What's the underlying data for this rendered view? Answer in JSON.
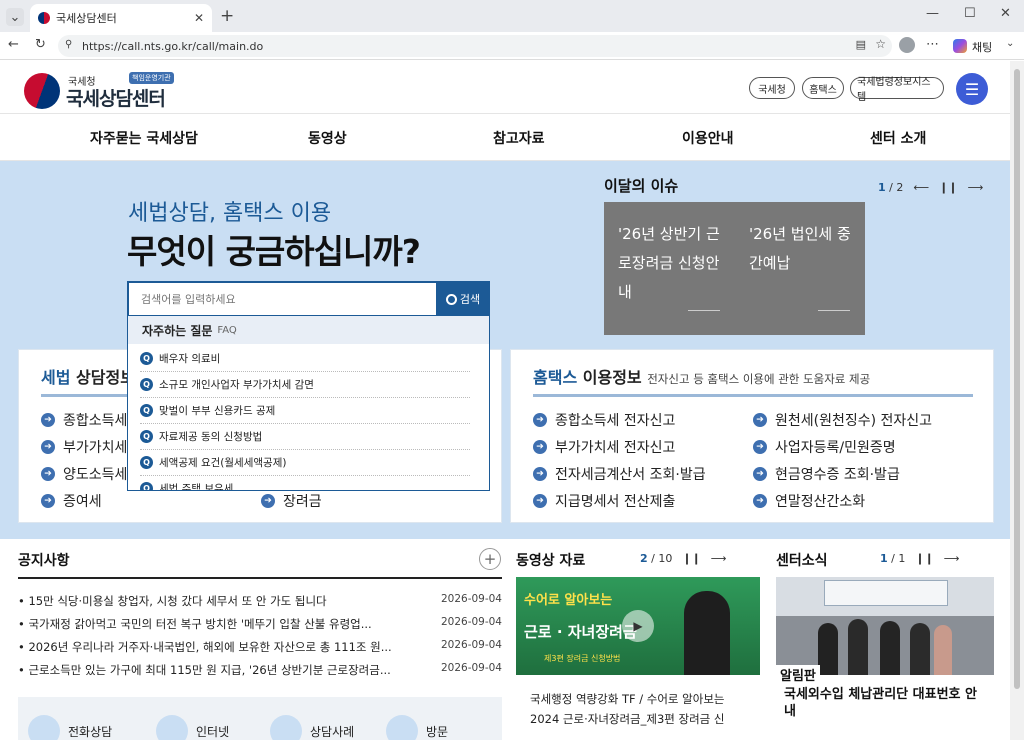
{
  "browser": {
    "tab_title": "국세상담센터",
    "url": "https://call.nts.go.kr/call/main.do",
    "chat_label": "채팅"
  },
  "header": {
    "logo_small": "국세청",
    "logo_main": "국세상담센터",
    "logo_badge": "책임운영기관",
    "links": [
      "국세청",
      "홈택스",
      "국세법령정보시스템"
    ]
  },
  "nav": [
    "자주묻는 국세상담",
    "동영상",
    "참고자료",
    "이용안내",
    "센터 소개"
  ],
  "hero": {
    "subtitle": "세법상담, 홈택스 이용",
    "title": "무엇이 궁금하십니까?",
    "search_placeholder": "검색어를 입력하세요",
    "search_button": "검색",
    "faq_title": "자주하는 질문",
    "faq_sub": "FAQ",
    "faq_items": [
      "배우자 의료비",
      "소규모 개인사업자 부가가치세 감면",
      "맞벌이 부부 신용카드 공제",
      "자료제공 동의 신청방법",
      "세액공제 요건(월세세액공제)",
      "세법 주택 보유세"
    ]
  },
  "issue": {
    "title": "이달의 이슈",
    "page_current": "1",
    "page_total": "/ 2",
    "cards": [
      {
        "text": "'26년 상반기 근로장려금 신청안내"
      },
      {
        "text": "'26년 법인세 중간예납"
      }
    ]
  },
  "tax_card": {
    "title_accent": "세법",
    "title": "상담정보",
    "left": [
      "종합소득세",
      "부가가치세",
      "양도소득세",
      "증여세"
    ],
    "right": [
      "",
      "",
      "",
      "장려금"
    ]
  },
  "hometax_card": {
    "title_accent": "홈택스",
    "title": "이용정보",
    "desc": "전자신고 등 홈택스 이용에 관한 도움자료 제공",
    "left": [
      "종합소득세 전자신고",
      "부가가치세 전자신고",
      "전자세금계산서 조회·발급",
      "지급명세서 전산제출"
    ],
    "right": [
      "원천세(원천징수) 전자신고",
      "사업자등록/민원증명",
      "현금영수증 조회·발급",
      "연말정산간소화"
    ]
  },
  "notice": {
    "title": "공지사항",
    "items": [
      {
        "text": "15만 식당·미용실 창업자, 시청 갔다 세무서 또 안 가도 됩니다",
        "date": "2026-09-04"
      },
      {
        "text": "국가재정 갉아먹고 국민의 터전 복구 방치한 '메뚜기 입찰 산불 유령업...",
        "date": "2026-09-04"
      },
      {
        "text": "2026년 우리나라 거주자·내국법인, 해외에 보유한 자산으로 총 111조 원...",
        "date": "2026-09-04"
      },
      {
        "text": "근로소득만 있는 가구에 최대 115만 원 지급, '26년 상반기분 근로장려금...",
        "date": "2026-09-04"
      }
    ]
  },
  "video": {
    "title": "동영상 자료",
    "page_current": "2",
    "page_total": "/ 10",
    "thumb_line1": "수어로 알아보는",
    "thumb_line2": "근로 · 자녀장려금",
    "thumb_line3": "제3편 장려금 신청방법",
    "caption": "국세행정 역량강화 TF / 수어로 알아보는 2024 근로·자녀장려금_제3편 장려금 신"
  },
  "center_news": {
    "title": "센터소식",
    "page_current": "1",
    "page_total": "/ 1",
    "tag": "알림판",
    "caption": "국세외수입 체납관리단 대표번호 안내"
  },
  "quick": [
    "전화상담",
    "인터넷",
    "상담사례",
    "방문"
  ],
  "colors": {
    "brand_blue": "#1c5a96",
    "hero_bg": "#c9def3",
    "issue_card": "#787878"
  }
}
